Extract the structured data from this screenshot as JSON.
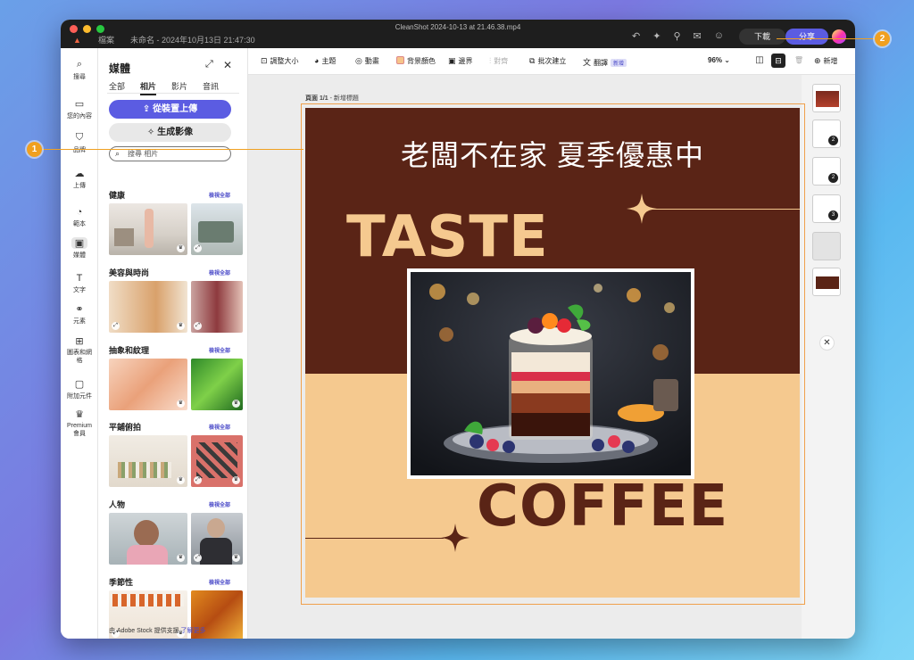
{
  "titlebar": {
    "recording_title": "CleanShot 2024-10-13 at 21.46.38.mp4",
    "file_menu": "檔案",
    "doc_name": "未命名 - 2024年10月13日 21:47:30",
    "download_label": "下載",
    "share_label": "分享"
  },
  "rail": {
    "items": [
      {
        "label": "搜尋",
        "icon": "search-icon"
      },
      {
        "label": "您的內容",
        "icon": "folder-icon"
      },
      {
        "label": "品牌",
        "icon": "brand-icon"
      },
      {
        "label": "上傳",
        "icon": "upload-icon"
      },
      {
        "label": "範本",
        "icon": "template-icon"
      },
      {
        "label": "媒體",
        "icon": "media-icon"
      },
      {
        "label": "文字",
        "icon": "text-icon"
      },
      {
        "label": "元素",
        "icon": "elements-icon"
      },
      {
        "label": "圖表和網格",
        "icon": "grid-icon"
      },
      {
        "label": "附加元件",
        "icon": "addon-icon"
      },
      {
        "label": "Premium 會員",
        "icon": "crown-icon"
      }
    ]
  },
  "panel": {
    "title": "媒體",
    "tabs": [
      "全部",
      "相片",
      "影片",
      "音訊"
    ],
    "active_tab": "相片",
    "upload_label": "從裝置上傳",
    "generate_label": "生成影像",
    "search_placeholder": "搜尋 相片",
    "see_all": "檢視全部",
    "sections": [
      "健康",
      "美容與時尚",
      "抽象和紋理",
      "平鋪俯拍",
      "人物",
      "季節性"
    ],
    "stock_note": "由 Adobe Stock 提供支援",
    "learn_more": "了解更多"
  },
  "toolbar": {
    "resize": "調整大小",
    "theme": "主題",
    "animation": "動畫",
    "bg_color": "背景顏色",
    "border": "邊界",
    "align": "對齊",
    "batch": "批次建立",
    "translate": "翻譯",
    "new_badge": "新增",
    "zoom": "96%",
    "add": "新增"
  },
  "canvas": {
    "page_label_prefix": "頁面 1/1",
    "page_label_title": " - 新增標題",
    "headline": "老闆不在家  夏季優惠中",
    "word_top": "TASTE",
    "word_bottom": "COFFEE"
  },
  "pages": {
    "badges": [
      "2",
      "2",
      "3"
    ]
  },
  "callouts": [
    "1",
    "2"
  ],
  "colors": {
    "poster_brown": "#5a2416",
    "poster_peach": "#f5c98f",
    "accent": "#5b5ce2",
    "callout": "#f0a020"
  }
}
